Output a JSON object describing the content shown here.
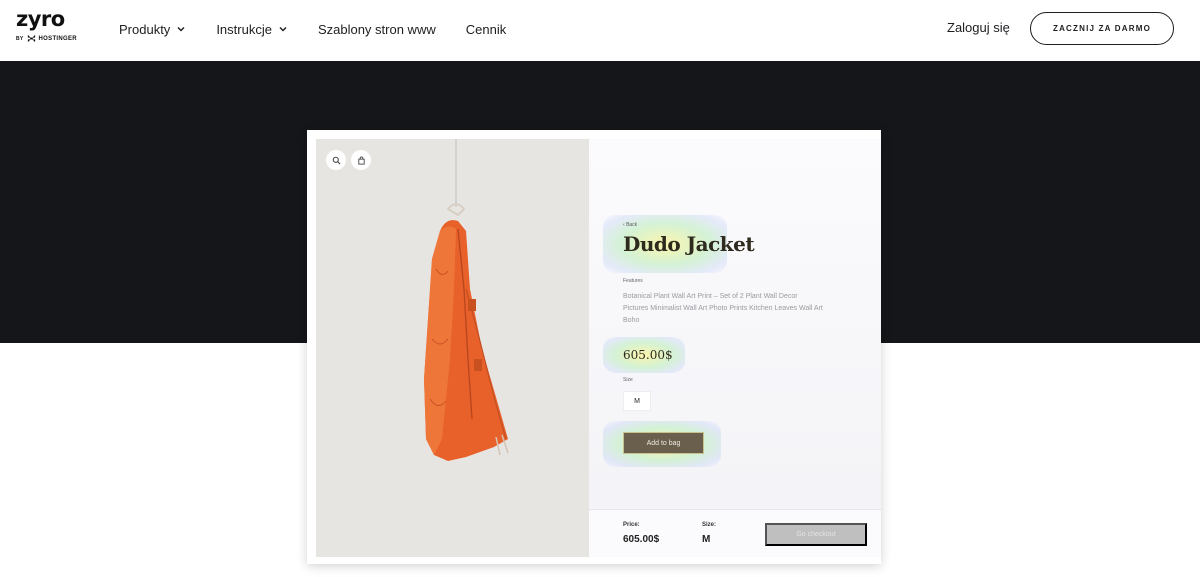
{
  "brand": {
    "logo_text": "zyro",
    "by_text": "BY",
    "partner_text": "HOSTINGER"
  },
  "nav": {
    "items": [
      {
        "label": "Produkty",
        "has_dropdown": true
      },
      {
        "label": "Instrukcje",
        "has_dropdown": true
      },
      {
        "label": "Szablony stron www",
        "has_dropdown": false
      },
      {
        "label": "Cennik",
        "has_dropdown": false
      }
    ],
    "login_label": "Zaloguj się",
    "cta_label": "ZACZNIJ ZA DARMO"
  },
  "product": {
    "back_label": "Back",
    "title": "Dudo Jacket",
    "features_label": "Features",
    "features_text": "Botanical Plant Wall Art Print – Set of 2 Plant Wall Decor Pictures Minimalist Wall Art Photo Prints Kitchen Leaves Wall Art Boho",
    "price": "605.00$",
    "size_label": "Size",
    "size_value": "M",
    "add_to_bag_label": "Add to bag"
  },
  "summary_bar": {
    "price_label": "Price:",
    "price_value": "605.00$",
    "size_label": "Size:",
    "size_value": "M",
    "checkout_label": "Go checkout"
  },
  "icons": [
    "zoom-icon",
    "shopping-bag-icon",
    "close-icon",
    "chevron-down-icon",
    "hostinger-logo-icon"
  ],
  "colors": {
    "hero_background": "#151619",
    "jacket_orange": "#e8602a",
    "add_to_bag_button": "#6a5e4d",
    "checkout_disabled": "#bfbfbf",
    "highlight_glow": "#f5f2a8"
  }
}
